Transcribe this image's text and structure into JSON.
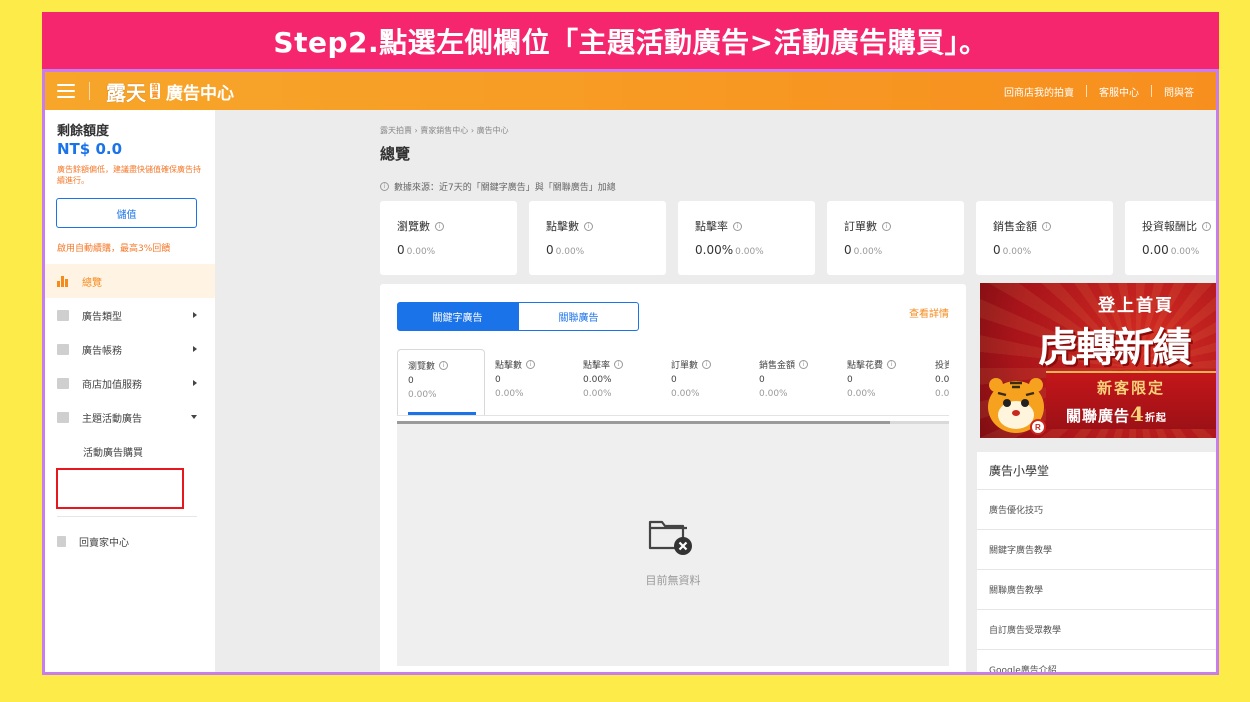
{
  "banner": {
    "text": "Step2.點選左側欄位「主題活動廣告>活動廣告購買」。"
  },
  "header": {
    "logo_main": "露天",
    "logo_badge": "拍賣",
    "logo_sub": "廣告中心",
    "links": [
      "回商店我的拍賣",
      "客服中心",
      "問與答"
    ],
    "gradient": [
      "#f7a62a",
      "#f78f1e"
    ]
  },
  "sidebar": {
    "balance_title": "剩餘額度",
    "balance_value": "NT$ 0.0",
    "balance_warning": "廣告餘額偏低，建議盡快儲值確保廣告持續進行。",
    "deposit_label": "儲值",
    "autopay_text": "啟用自動續購，最高3%回饋",
    "items": [
      {
        "label": "總覽",
        "icon": "chart-icon",
        "active": true
      },
      {
        "label": "廣告類型",
        "icon": "ad-type-icon",
        "arrow": "right"
      },
      {
        "label": "廣告帳務",
        "icon": "billing-icon",
        "arrow": "right"
      },
      {
        "label": "商店加值服務",
        "icon": "store-service-icon",
        "arrow": "right"
      },
      {
        "label": "主題活動廣告",
        "icon": "campaign-icon",
        "arrow": "down"
      }
    ],
    "sub_item": "活動廣告購買",
    "back_label": "回賣家中心"
  },
  "main": {
    "breadcrumb": "露天拍賣 › 賣家銷售中心 › 廣告中心",
    "title": "總覽",
    "source_note": "數據來源：近7天的「關鍵字廣告」與「關聯廣告」加總",
    "cards": [
      {
        "label": "瀏覽數",
        "value": "0",
        "pct": "0.00%"
      },
      {
        "label": "點擊數",
        "value": "0",
        "pct": "0.00%"
      },
      {
        "label": "點擊率",
        "value": "0.00%",
        "pct": "0.00%"
      },
      {
        "label": "訂單數",
        "value": "0",
        "pct": "0.00%"
      },
      {
        "label": "銷售金額",
        "value": "0",
        "pct": "0.00%"
      },
      {
        "label": "投資報酬比",
        "value": "0.00",
        "pct": "0.00%"
      }
    ],
    "tabs": [
      "關鍵字廣告",
      "關聯廣告"
    ],
    "more_link": "查看詳情",
    "metrics": [
      {
        "label": "瀏覽數",
        "value": "0",
        "pct": "0.00%"
      },
      {
        "label": "點擊數",
        "value": "0",
        "pct": "0.00%"
      },
      {
        "label": "點擊率",
        "value": "0.00%",
        "pct": "0.00%"
      },
      {
        "label": "訂單數",
        "value": "0",
        "pct": "0.00%"
      },
      {
        "label": "銷售金額",
        "value": "0",
        "pct": "0.00%"
      },
      {
        "label": "點擊花費",
        "value": "0",
        "pct": "0.00%"
      },
      {
        "label": "投資",
        "value": "0.0",
        "pct": "0.0"
      }
    ],
    "empty_text": "目前無資料"
  },
  "promo": {
    "top": "登上首頁",
    "big": "虎轉新績",
    "line1": "新客限定",
    "line2_a": "關聯廣告",
    "line2_b": "4",
    "line2_c": "折起"
  },
  "academy": {
    "title": "廣告小學堂",
    "items": [
      "廣告優化技巧",
      "關鍵字廣告教學",
      "關聯廣告教學",
      "自訂廣告受眾教學",
      "Google廣告介紹"
    ]
  },
  "colors": {
    "banner": "#f5266e",
    "page_bg": "#fdeb4a",
    "accent_blue": "#1a73e8",
    "accent_orange": "#f58a1d",
    "highlight": "#e8161d",
    "frame": "#c77cf0"
  }
}
